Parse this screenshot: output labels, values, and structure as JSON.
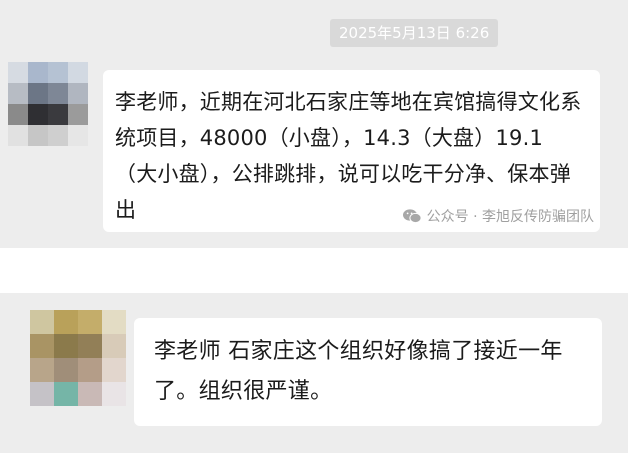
{
  "chat": {
    "messages": [
      {
        "timestamp": "2025年5月13日 6:26",
        "text": "李老师，近期在河北石家庄等地在宾馆搞得文化系统项目，48000（小盘），14.3（大盘）19.1（大小盘），公排跳排，说可以吃干分净、保本弹出",
        "watermark": "公众号 · 李旭反传防骗团队",
        "watermark_icon": "wechat-icon",
        "avatar": "blurred-avatar"
      },
      {
        "text": "李老师 石家庄这个组织好像搞了接近一年了。组织很严谨。",
        "avatar": "blurred-avatar"
      }
    ]
  },
  "colors": {
    "panel_bg": "#ededed",
    "bubble_bg": "#ffffff",
    "timestamp_bg": "#d9d9d9",
    "text": "#1b1b1b",
    "watermark": "#a0a0a0"
  }
}
